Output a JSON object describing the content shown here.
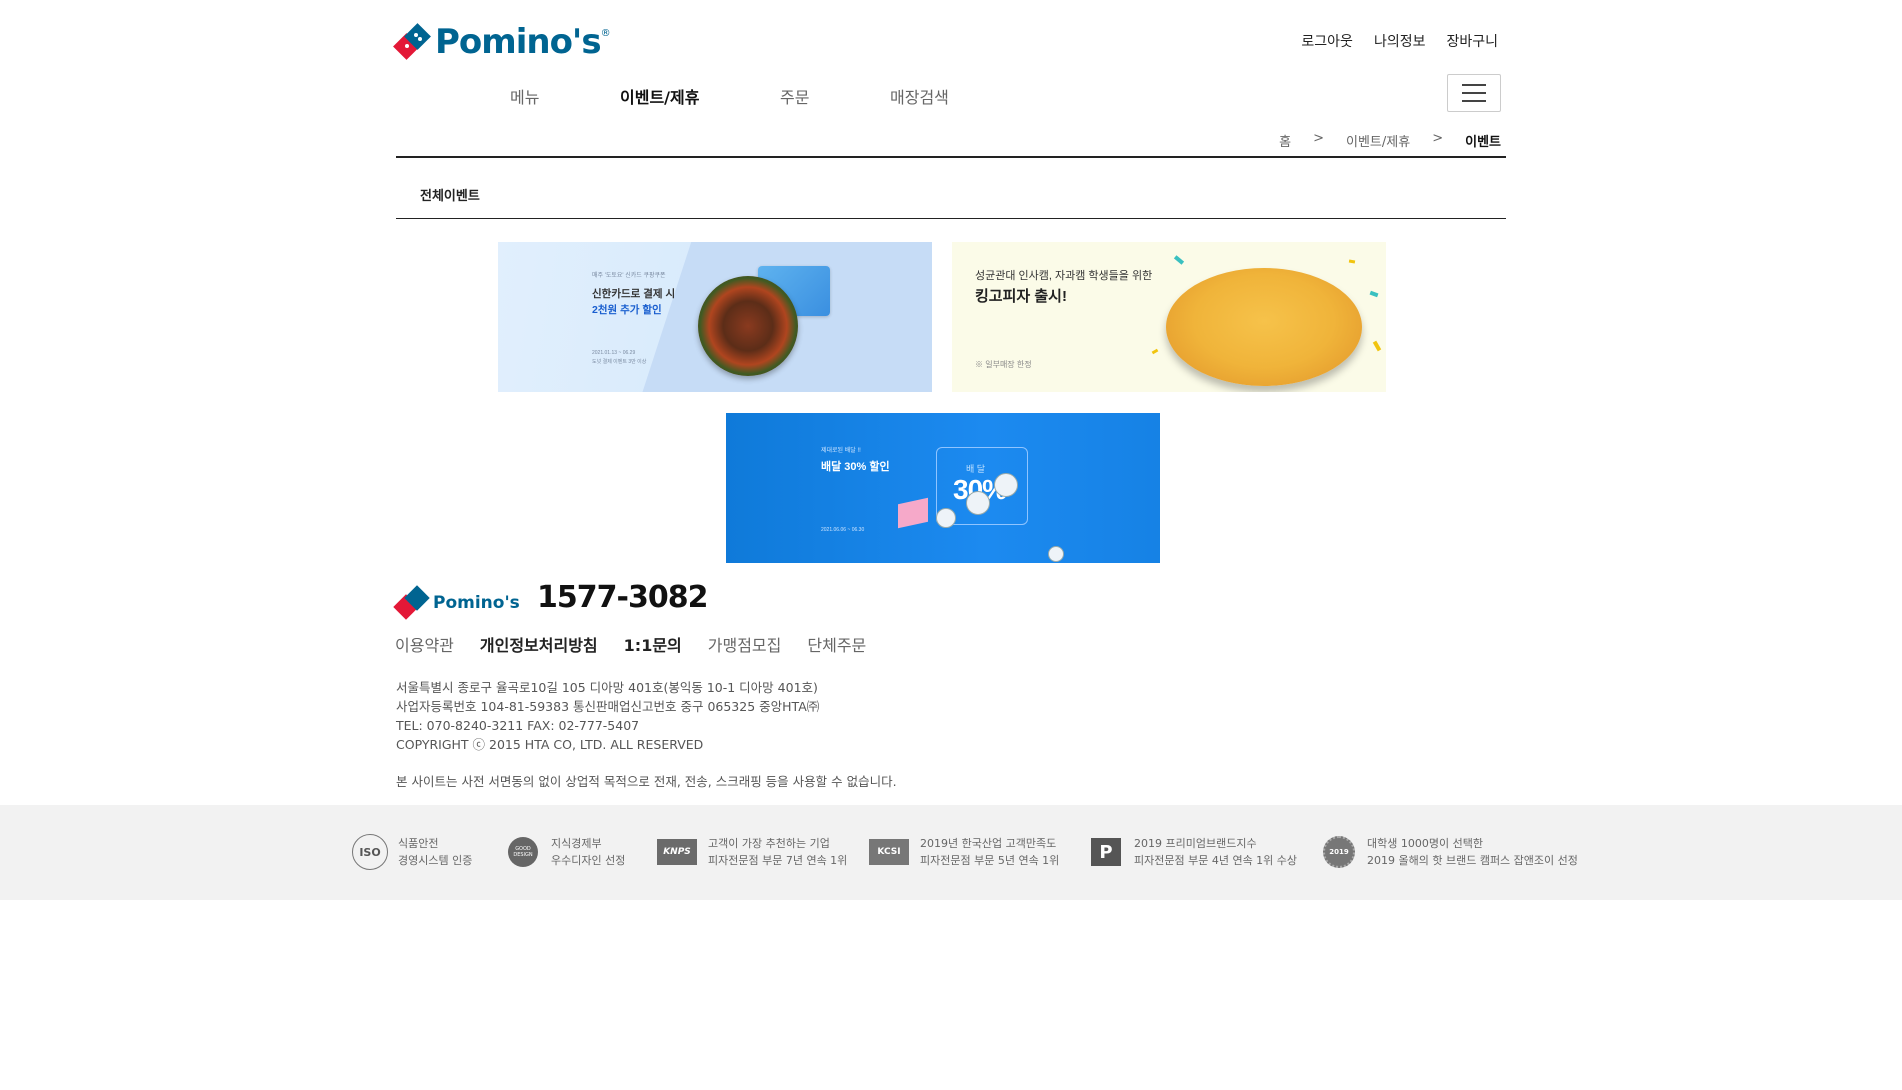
{
  "header": {
    "logo_text": "Pomino's",
    "util_links": [
      "로그아웃",
      "나의정보",
      "장바구니"
    ],
    "nav": [
      "메뉴",
      "이벤트/제휴",
      "주문",
      "매장검색"
    ],
    "breadcrumb": [
      "홈",
      ">",
      "이벤트/제휴",
      ">",
      "이벤트"
    ]
  },
  "subnav": {
    "tab": "전체이벤트"
  },
  "banners": [
    {
      "line_small": "매주 '도토요' 신카드 쿠팡쿠폰",
      "line1": "신한카드로 결제 시",
      "line2": "2천원 추가 할인",
      "date": "2021.01.13 ~ 06.29",
      "note": "도넛 결제 이벤트 3만 이상"
    },
    {
      "line_small": "성균관대 인사캠, 자과캠 학생들을 위한",
      "line1": "킹고피자 출시!",
      "note": "※ 일부매장 한정"
    },
    {
      "line_small": "제대로된 배달 !!",
      "line1": "배달 30% 할인",
      "date": "2021.06.06 ~ 06.30",
      "badge_small": "배 달",
      "badge_big": "30%"
    }
  ],
  "footer": {
    "logo_text": "Pomino's",
    "phone": "1577-3082",
    "links": [
      "이용약관",
      "개인정보처리방침",
      "1:1문의",
      "가맹점모집",
      "단체주문"
    ],
    "address": [
      "서울특별시 종로구 율곡로10길 105 디아망 401호(봉익동 10-1 디아망 401호)",
      "사업자등록번호 104-81-59383 통신판매업신고번호 중구 065325 중앙HTA㈜",
      "TEL: 070-8240-3211 FAX: 02-777-5407",
      "COPYRIGHT ⓒ 2015 HTA CO, LTD. ALL RESERVED"
    ],
    "notice": "본 사이트는 사전 서면동의 없이 상업적 목적으로 전재, 전송, 스크래핑 등을 사용할 수 없습니다.",
    "certs": [
      {
        "icon": "iso-icon",
        "label": "ISO",
        "line1": "식품안전",
        "line2": "경영시스템 인증"
      },
      {
        "icon": "good-design-icon",
        "label": "GOOD DESIGN",
        "line1": "지식경제부",
        "line2": "우수디자인 선정"
      },
      {
        "icon": "knps-icon",
        "label": "KNPS",
        "line1": "고객이 가장 추천하는 기업",
        "line2": "피자전문점 부문 7년 연속 1위"
      },
      {
        "icon": "kcsi-icon",
        "label": "KCSI",
        "line1": "2019년 한국산업 고객만족도",
        "line2": "피자전문점 부문 5년 연속 1위"
      },
      {
        "icon": "premium-brand-icon",
        "label": "P",
        "line1": "2019 프리미엄브랜드지수",
        "line2": "피자전문점 부문 4년 연속 1위 수상"
      },
      {
        "icon": "campus-award-icon",
        "label": "2019",
        "line1": "대학생 1000명이 선택한",
        "line2": "2019 올해의 핫 브랜드 캠퍼스 잡앤조이 선정"
      }
    ]
  }
}
